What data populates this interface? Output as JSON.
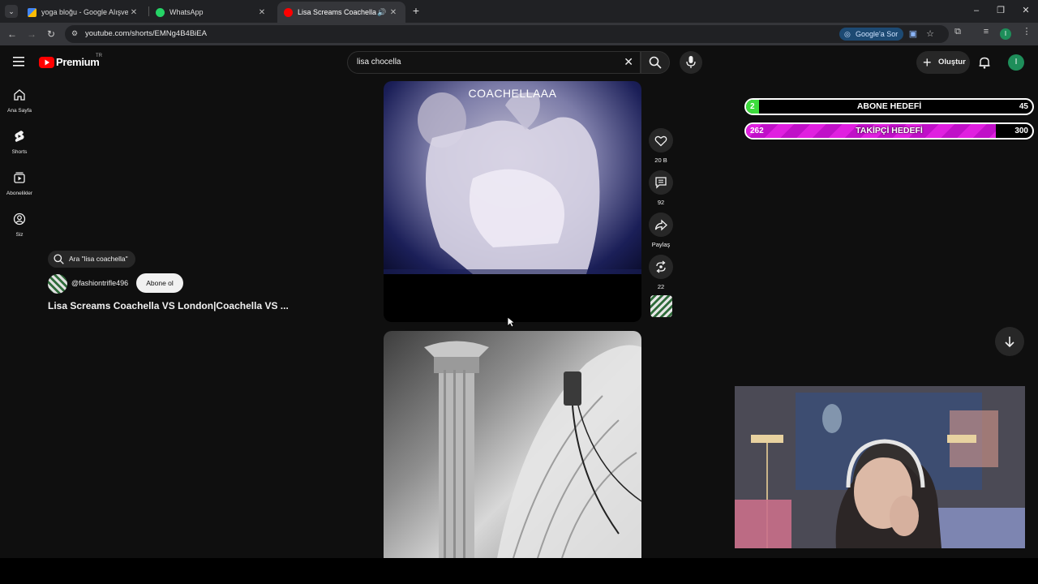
{
  "browser": {
    "tabs": [
      {
        "title": "yoga bloğu - Google Alışveriş",
        "favicon_color": "#34a853"
      },
      {
        "title": "WhatsApp",
        "favicon_color": "#25d366"
      },
      {
        "title": "Lisa Screams Coachella VS",
        "favicon_color": "#ff0000",
        "active": true
      }
    ],
    "url": "youtube.com/shorts/EMNg4B4BiEA",
    "ask_google_label": "Google'a Sor",
    "profile_initial": "I"
  },
  "youtube": {
    "logo_text": "Premium",
    "logo_region": "TR",
    "search_value": "lisa chocella",
    "create_label": "Oluştur",
    "avatar_initial": "I",
    "accent_color": "#ff0000"
  },
  "sidebar": {
    "items": [
      {
        "label": "Ana Sayfa",
        "icon": "home-icon"
      },
      {
        "label": "Shorts",
        "icon": "shorts-icon"
      },
      {
        "label": "Abonelikler",
        "icon": "subscriptions-icon"
      },
      {
        "label": "Siz",
        "icon": "you-icon"
      }
    ]
  },
  "short": {
    "caption": "COACHELLAAA",
    "search_chip": "Ara \"lisa coachella\"",
    "channel": "@fashiontrifle496",
    "subscribe_label": "Abone ol",
    "title": "Lisa Screams Coachella VS London|Coachella VS ...",
    "actions": {
      "likes": "20 B",
      "comments": "92",
      "share": "Paylaş",
      "remix": "22"
    }
  },
  "goals": {
    "subscribers": {
      "label": "ABONE HEDEFİ",
      "current": "2",
      "target": "45",
      "progress": 0.044,
      "color": "#3ddc3d"
    },
    "followers": {
      "label": "TAKİPÇİ HEDEFİ",
      "current": "262",
      "target": "300",
      "progress": 0.873,
      "color": "#e020e0"
    }
  }
}
